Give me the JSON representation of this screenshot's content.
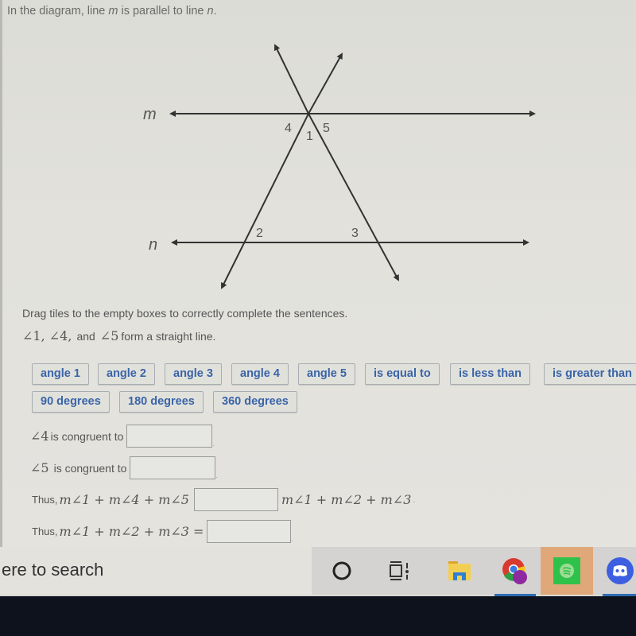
{
  "question": {
    "intro_prefix": "In the diagram, line ",
    "intro_m": "m",
    "intro_mid": " is parallel to line ",
    "intro_n": "n",
    "intro_suffix": "."
  },
  "diagram": {
    "line_labels": {
      "m": "m",
      "n": "n"
    },
    "angle_labels": {
      "a1": "1",
      "a2": "2",
      "a3": "3",
      "a4": "4",
      "a5": "5"
    }
  },
  "instructions": "Drag tiles to the empty boxes to correctly complete the sentences.",
  "straight_line": {
    "angles": "∠1,  ∠4,",
    "and": "and",
    "angle5": "∠5",
    "suffix": "form a straight line."
  },
  "tiles": [
    {
      "label": "angle 1"
    },
    {
      "label": "angle 2"
    },
    {
      "label": "angle 3"
    },
    {
      "label": "angle 4"
    },
    {
      "label": "angle 5"
    },
    {
      "label": "is equal to"
    },
    {
      "label": "is less than"
    },
    {
      "label": "is greater than"
    },
    {
      "label": "90 degrees"
    },
    {
      "label": "180 degrees"
    },
    {
      "label": "360 degrees"
    }
  ],
  "sentences": [
    {
      "math_prefix": "∠4",
      "text": "is congruent to",
      "value": "",
      "suffix": "."
    },
    {
      "math_prefix": "∠5",
      "text": "is congruent to",
      "value": "",
      "suffix": "."
    },
    {
      "text": "Thus,",
      "math": "m∠1 + m∠4 + m∠5",
      "value": "",
      "math_after": "m∠1 + m∠2 + m∠3",
      "suffix": "."
    },
    {
      "text": "Thus,",
      "math": "m∠1 + m∠2 + m∠3 =",
      "value": "",
      "suffix": "."
    }
  ],
  "taskbar": {
    "search_placeholder": "ere to search",
    "icons": [
      "cortana-icon",
      "task-view-icon",
      "file-explorer-icon",
      "chrome-icon",
      "spotify-icon",
      "discord-icon"
    ]
  }
}
